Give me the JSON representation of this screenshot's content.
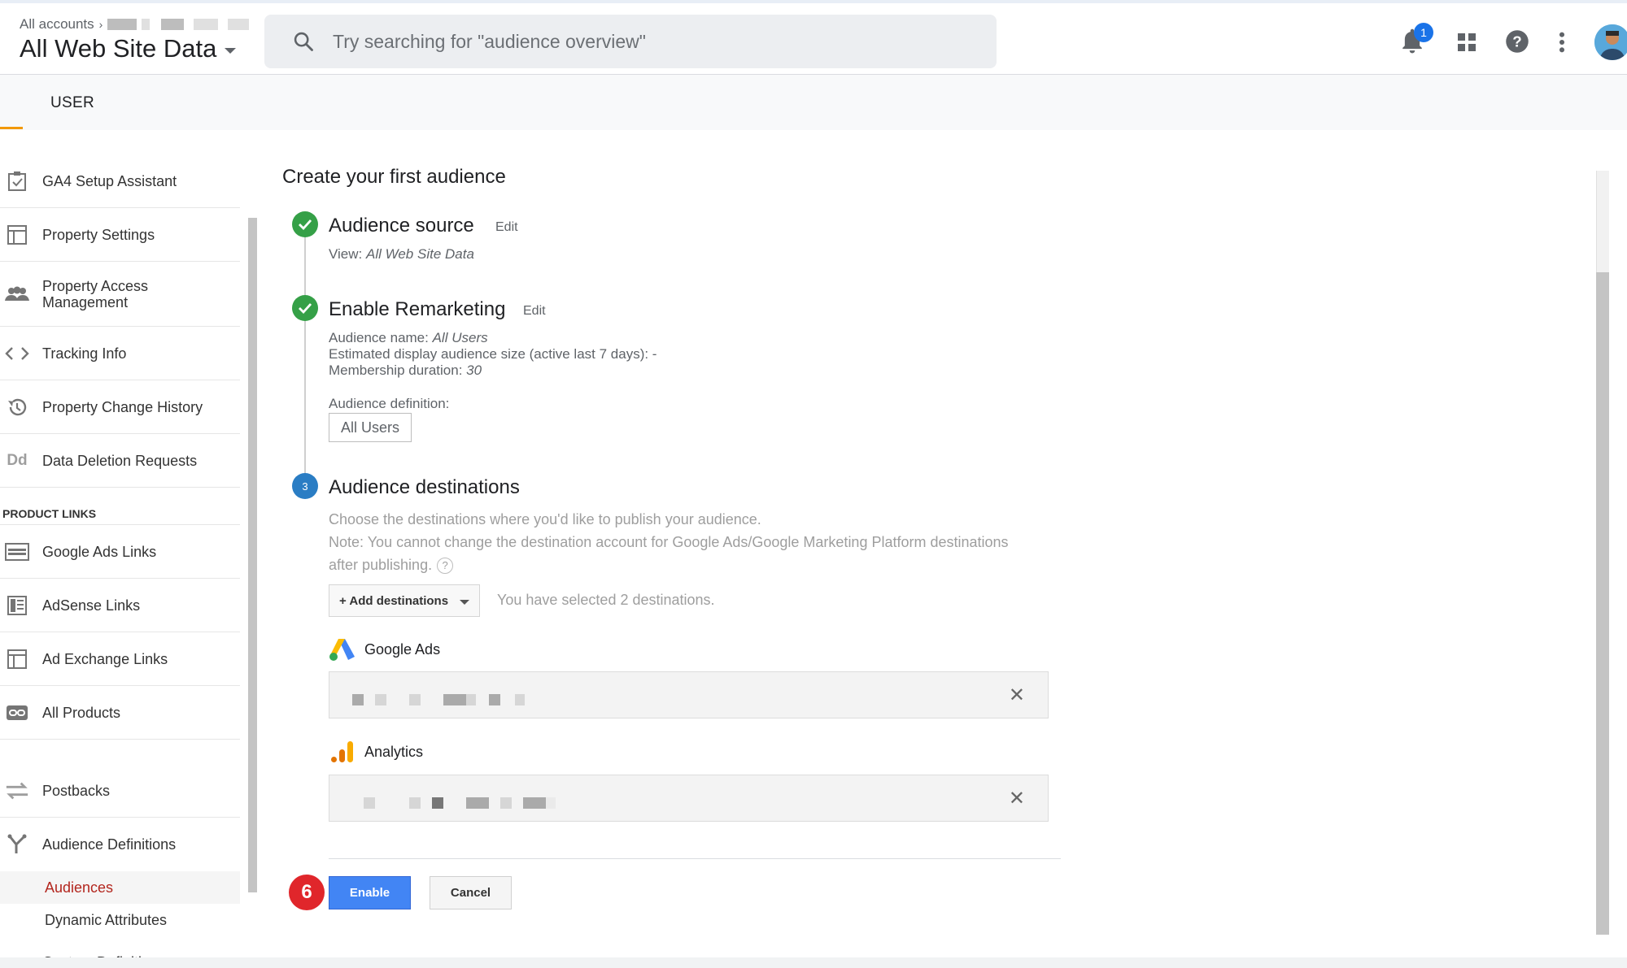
{
  "header": {
    "breadcrumb_label": "All accounts",
    "view_name": "All Web Site Data",
    "search_placeholder": "Try searching for \"audience overview\"",
    "notification_count": "1",
    "icons": [
      "search-icon",
      "bell-icon",
      "apps-grid-icon",
      "help-icon",
      "more-vert-icon"
    ]
  },
  "subheader": {
    "tab_label": "USER",
    "tab_indicator_color": "#f29900"
  },
  "sidebar": {
    "items": [
      {
        "label": "GA4 Setup Assistant",
        "icon": "checklist-icon"
      },
      {
        "label": "Property Settings",
        "icon": "layout-icon"
      },
      {
        "label": "Property Access Management",
        "icon": "people-icon"
      },
      {
        "label": "Tracking Info",
        "icon": "code-brackets-icon"
      },
      {
        "label": "Property Change History",
        "icon": "history-icon"
      },
      {
        "label": "Data Deletion Requests",
        "icon": "dd-icon"
      }
    ],
    "product_links_title": "PRODUCT LINKS",
    "product_links": [
      {
        "label": "Google Ads Links",
        "icon": "ads-links-icon"
      },
      {
        "label": "AdSense Links",
        "icon": "adsense-icon"
      },
      {
        "label": "Ad Exchange Links",
        "icon": "ad-exchange-icon"
      },
      {
        "label": "All Products",
        "icon": "link-icon"
      }
    ],
    "postbacks_label": "Postbacks",
    "audience_definitions_label": "Audience Definitions",
    "audience_sub": {
      "audiences": "Audiences",
      "dynamic_attributes": "Dynamic Attributes"
    },
    "custom_definitions_label": "Custom Definitions",
    "active_color": "#b3261e"
  },
  "main": {
    "title": "Create your first audience",
    "step1": {
      "title": "Audience source",
      "edit": "Edit",
      "view_prefix": "View: ",
      "view_value": "All Web Site Data"
    },
    "step2": {
      "title": "Enable Remarketing",
      "edit": "Edit",
      "name_prefix": "Audience name: ",
      "name_value": "All Users",
      "size_text": "Estimated display audience size (active last 7 days): -",
      "duration_prefix": "Membership duration: ",
      "duration_value": "30",
      "definition_label": "Audience definition:",
      "definition_value": "All Users"
    },
    "step3": {
      "number": "3",
      "title": "Audience destinations",
      "desc1": "Choose the destinations where you'd like to publish your audience.",
      "desc2": "Note: You cannot change the destination account for Google Ads/Google Marketing Platform destinations",
      "desc3": "after publishing.",
      "help_glyph": "?",
      "add_button": "+ Add destinations",
      "selected_text": "You have selected 2 destinations.",
      "destinations": [
        {
          "name": "Google Ads",
          "icon": "google-ads-logo-icon"
        },
        {
          "name": "Analytics",
          "icon": "analytics-logo-icon"
        }
      ],
      "remove_glyph": "✕"
    },
    "buttons": {
      "enable": "Enable",
      "cancel": "Cancel"
    },
    "step_marker": "6",
    "colors": {
      "check_green": "#35a047",
      "step_blue": "#2a7dc4",
      "enable_blue": "#4285f4",
      "marker_red": "#e0262b"
    }
  }
}
